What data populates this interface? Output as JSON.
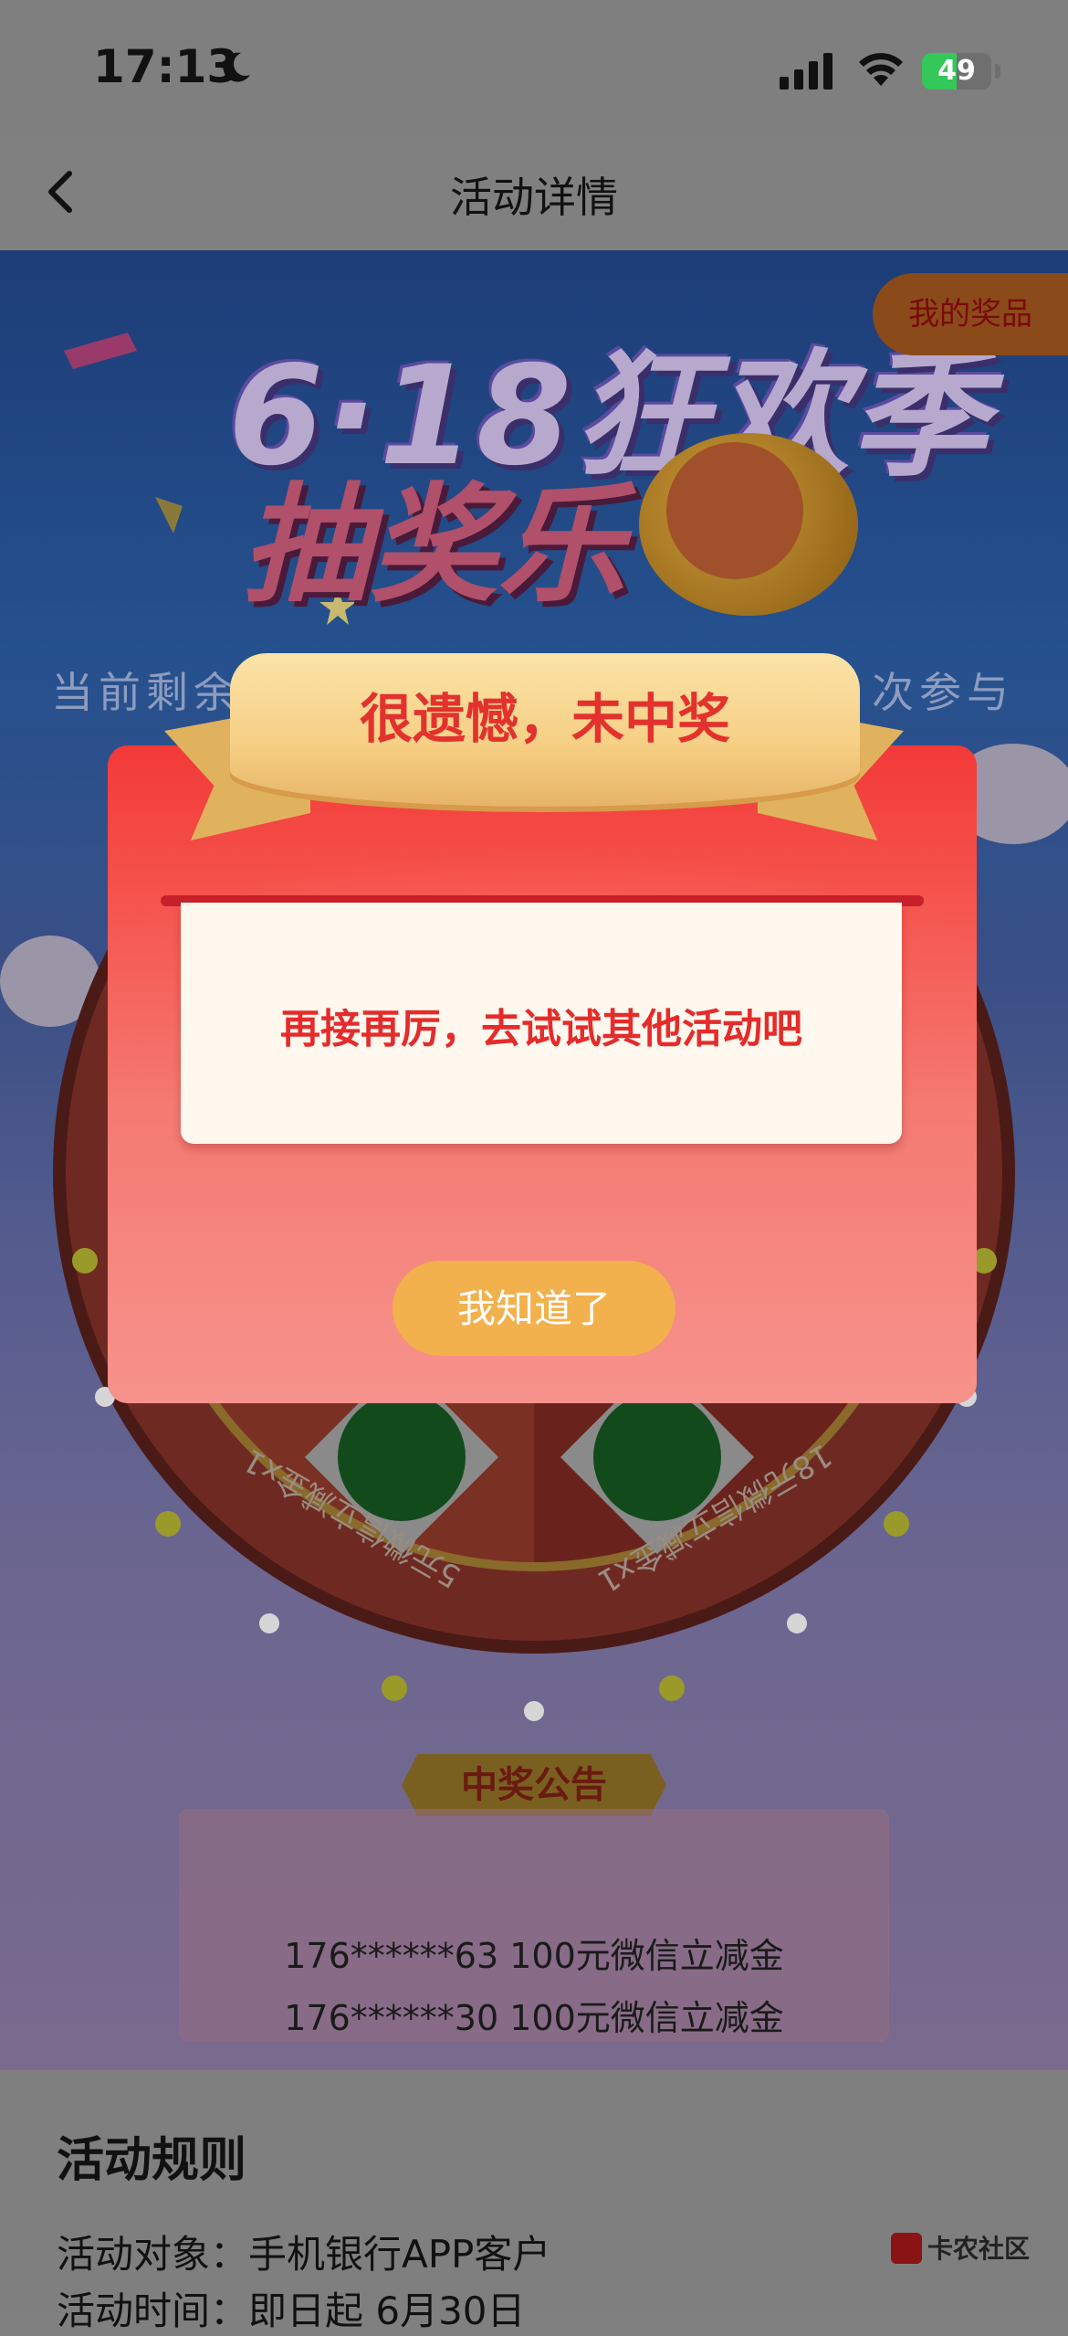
{
  "status_bar": {
    "time": "17:13",
    "battery": "49"
  },
  "nav": {
    "title": "活动详情"
  },
  "hero": {
    "title_line1": "6·18狂欢季",
    "title_line2": "抽奖乐",
    "my_prizes": "我的奖品",
    "remaining_left": "当前剩余",
    "remaining_right": "次参与"
  },
  "wheel": {
    "prize_left": "5元微信立减金x1",
    "prize_right": "18元微信立减金x1"
  },
  "dialog": {
    "title": "很遗憾，未中奖",
    "message": "再接再厉，去试试其他活动吧",
    "ok_button": "我知道了"
  },
  "announcement": {
    "title": "中奖公告",
    "lines": [
      "176******63 100元微信立减金",
      "176******30 100元微信立减金"
    ]
  },
  "rules": {
    "title": "活动规则",
    "target": "活动对象：手机银行APP客户",
    "time": "活动时间：即日起 6月30日"
  },
  "watermark": "卡农社区",
  "colors": {
    "dialog_red": "#f23a38",
    "button_gold": "#f2b14c",
    "ribbon_gold": "#f6cf84",
    "message_red": "#e52b2b"
  }
}
